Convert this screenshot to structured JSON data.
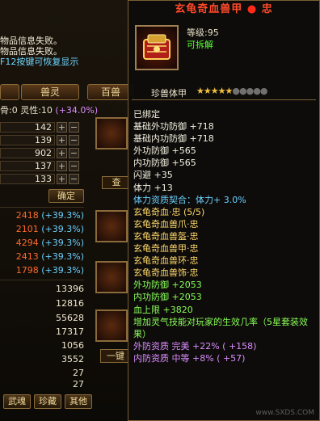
{
  "background": {
    "messages": [
      {
        "text": "物品信息失败。",
        "kind": "fail"
      },
      {
        "text": "物品信息失败。",
        "kind": "fail"
      },
      {
        "text": "F12按键可恢复显示",
        "kind": "info"
      }
    ],
    "tabs": [
      "",
      "兽灵",
      "百兽"
    ],
    "ling_line": {
      "left": "骨:0",
      "mid": "灵性:10",
      "pct": "(+34.0%)"
    },
    "steppers": [
      {
        "value": "142"
      },
      {
        "value": "139"
      },
      {
        "value": "902"
      },
      {
        "value": "137"
      },
      {
        "value": "133"
      }
    ],
    "confirm_label": "确定",
    "stats": [
      {
        "value": "2418",
        "pct": "(+39.3%)"
      },
      {
        "value": "2101",
        "pct": "(+39.3%)"
      },
      {
        "value": "4294",
        "pct": "(+39.3%)"
      },
      {
        "value": "2413",
        "pct": "(+39.3%)"
      },
      {
        "value": "1798",
        "pct": "(+39.3%)"
      }
    ],
    "numbers": [
      "13396",
      "12816",
      "55628",
      "17317",
      "1056",
      "3552",
      "27",
      "27"
    ],
    "query_label": "查",
    "yijian_label": "一键",
    "bottom_tabs": [
      "武魂",
      "珍藏",
      "其他"
    ]
  },
  "tooltip": {
    "title_left": "玄龟奇血兽甲",
    "title_dot": "●",
    "title_right": "忠",
    "level": "等级:95",
    "dismantle": "可拆解",
    "type": "珍兽体甲",
    "stars_on": 5,
    "stars_total": 10,
    "lines": [
      {
        "text": "已绑定",
        "color": "white"
      },
      {
        "text": "基础外功防御 +718",
        "color": "white"
      },
      {
        "text": "基础内功防御 +718",
        "color": "white"
      },
      {
        "text": "外功防御 +565",
        "color": "white"
      },
      {
        "text": "内功防御 +565",
        "color": "white"
      },
      {
        "text": "闪避 +35",
        "color": "white"
      },
      {
        "text": "体力 +13",
        "color": "white"
      },
      {
        "text": "体力资质契合：体力+ 3.0%",
        "color": "aqua"
      },
      {
        "text": "玄龟奇血·忠 (5/5)",
        "color": "gold"
      },
      {
        "text": "玄龟奇血兽爪·忠",
        "color": "gold"
      },
      {
        "text": "玄龟奇血兽盔·忠",
        "color": "gold"
      },
      {
        "text": "玄龟奇血兽甲·忠",
        "color": "gold"
      },
      {
        "text": "玄龟奇血兽环·忠",
        "color": "gold"
      },
      {
        "text": "玄龟奇血兽饰·忠",
        "color": "gold"
      },
      {
        "text": "外功防御 +2053",
        "color": "green"
      },
      {
        "text": "内功防御 +2053",
        "color": "green"
      },
      {
        "text": "血上限 +3820",
        "color": "green"
      },
      {
        "text": "增加灵气技能对玩家的生效几率（5星套装效果）",
        "color": "green",
        "wrap": true
      },
      {
        "text": "外防资质 完美 +22% ( +158)",
        "color": "purple"
      },
      {
        "text": "内防资质 中等 +8% ( +57)",
        "color": "purple"
      }
    ]
  },
  "watermark": "www.SXDS.COM"
}
